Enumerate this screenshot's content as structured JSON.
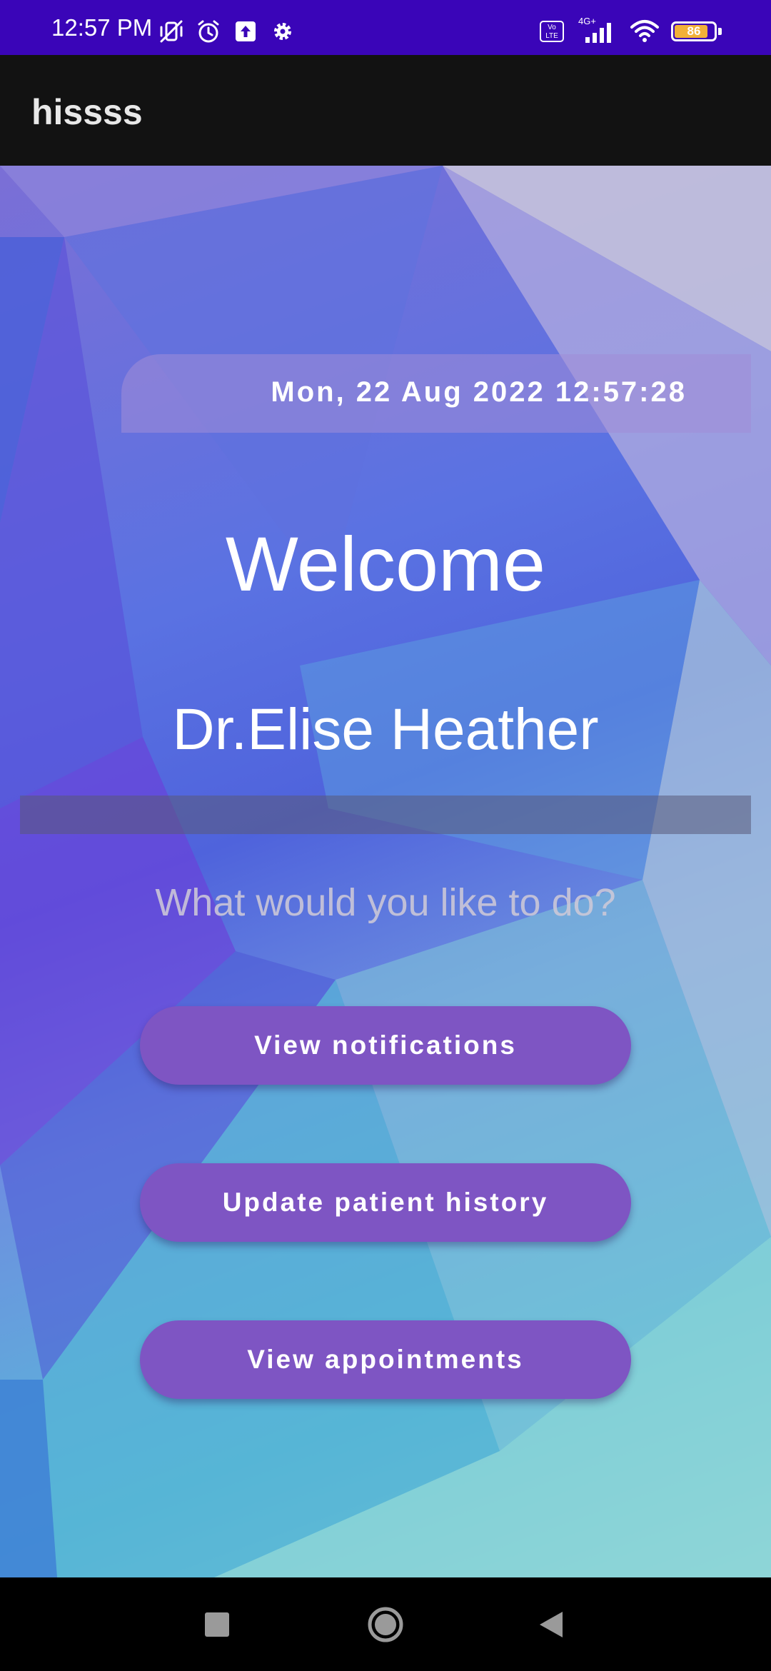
{
  "status_bar": {
    "time": "12:57 PM",
    "left_icons": [
      "vibrate-mute-icon",
      "alarm-icon",
      "upload-icon",
      "settings-gear-icon"
    ],
    "volte_label": "Vo LTE",
    "network_label": "4G+",
    "battery_level": "86",
    "battery_fraction": 0.86
  },
  "app_bar": {
    "title": "hissss"
  },
  "main": {
    "datetime": "Mon, 22 Aug 2022 12:57:28",
    "welcome": "Welcome",
    "doctor_name": "Dr.Elise Heather",
    "prompt": "What would you like to do?",
    "buttons": {
      "notifications": "View notifications",
      "patient_history": "Update patient history",
      "appointments": "View appointments"
    }
  },
  "nav_bar": {
    "icons": [
      "recent-apps-icon",
      "home-icon",
      "back-icon"
    ]
  },
  "colors": {
    "status_bar": "#3a05b8",
    "app_bar": "#121212",
    "button": "#7e55c3"
  }
}
